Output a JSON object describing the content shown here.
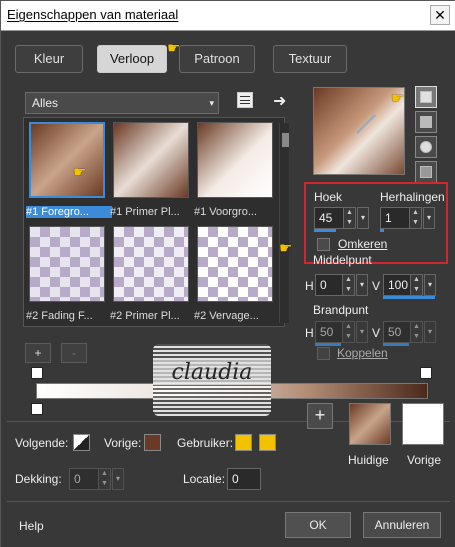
{
  "window": {
    "title": "Eigenschappen van materiaal",
    "close_glyph": "✕"
  },
  "tabs": [
    {
      "label": "Kleur"
    },
    {
      "label": "Verloop"
    },
    {
      "label": "Patroon"
    },
    {
      "label": "Textuur"
    }
  ],
  "active_tab": "Verloop",
  "category": {
    "value": "Alles",
    "arrow": "▾"
  },
  "gallery": [
    {
      "label": "#1 Foregro..."
    },
    {
      "label": "#1 Primer Pl..."
    },
    {
      "label": "#1 Voorgro..."
    },
    {
      "label": "#2 Fading F..."
    },
    {
      "label": "#2 Primer Pl..."
    },
    {
      "label": "#2 Vervage..."
    }
  ],
  "angle": {
    "label": "Hoek",
    "value": "45"
  },
  "repeats": {
    "label": "Herhalingen",
    "value": "1"
  },
  "invert": {
    "label": "Omkeren"
  },
  "midpoint": {
    "label": "Middelpunt",
    "h_label": "H",
    "h_value": "0",
    "v_label": "V",
    "v_value": "100"
  },
  "focus": {
    "label": "Brandpunt",
    "h_label": "H",
    "h_value": "50",
    "v_label": "V",
    "v_value": "50"
  },
  "link": {
    "label": "Koppelen"
  },
  "stops_buttons": {
    "add": "+",
    "remove": "-"
  },
  "watermark": {
    "text": "claudia"
  },
  "colors": {
    "following_label": "Volgende:",
    "previous_label": "Vorige:",
    "user_label": "Gebruiker:",
    "brown": "#6b3a24",
    "yellow": "#f2c200",
    "accent": "#3b8bd9",
    "highlight": "#d0272d"
  },
  "opacity": {
    "label": "Dekking:",
    "value": "0"
  },
  "location": {
    "label": "Locatie:",
    "value": "0"
  },
  "add_swatch": {
    "glyph": "+"
  },
  "current": {
    "label": "Huidige"
  },
  "previous": {
    "label": "Vorige"
  },
  "footer": {
    "help": "Help",
    "ok": "OK",
    "cancel": "Annuleren"
  }
}
